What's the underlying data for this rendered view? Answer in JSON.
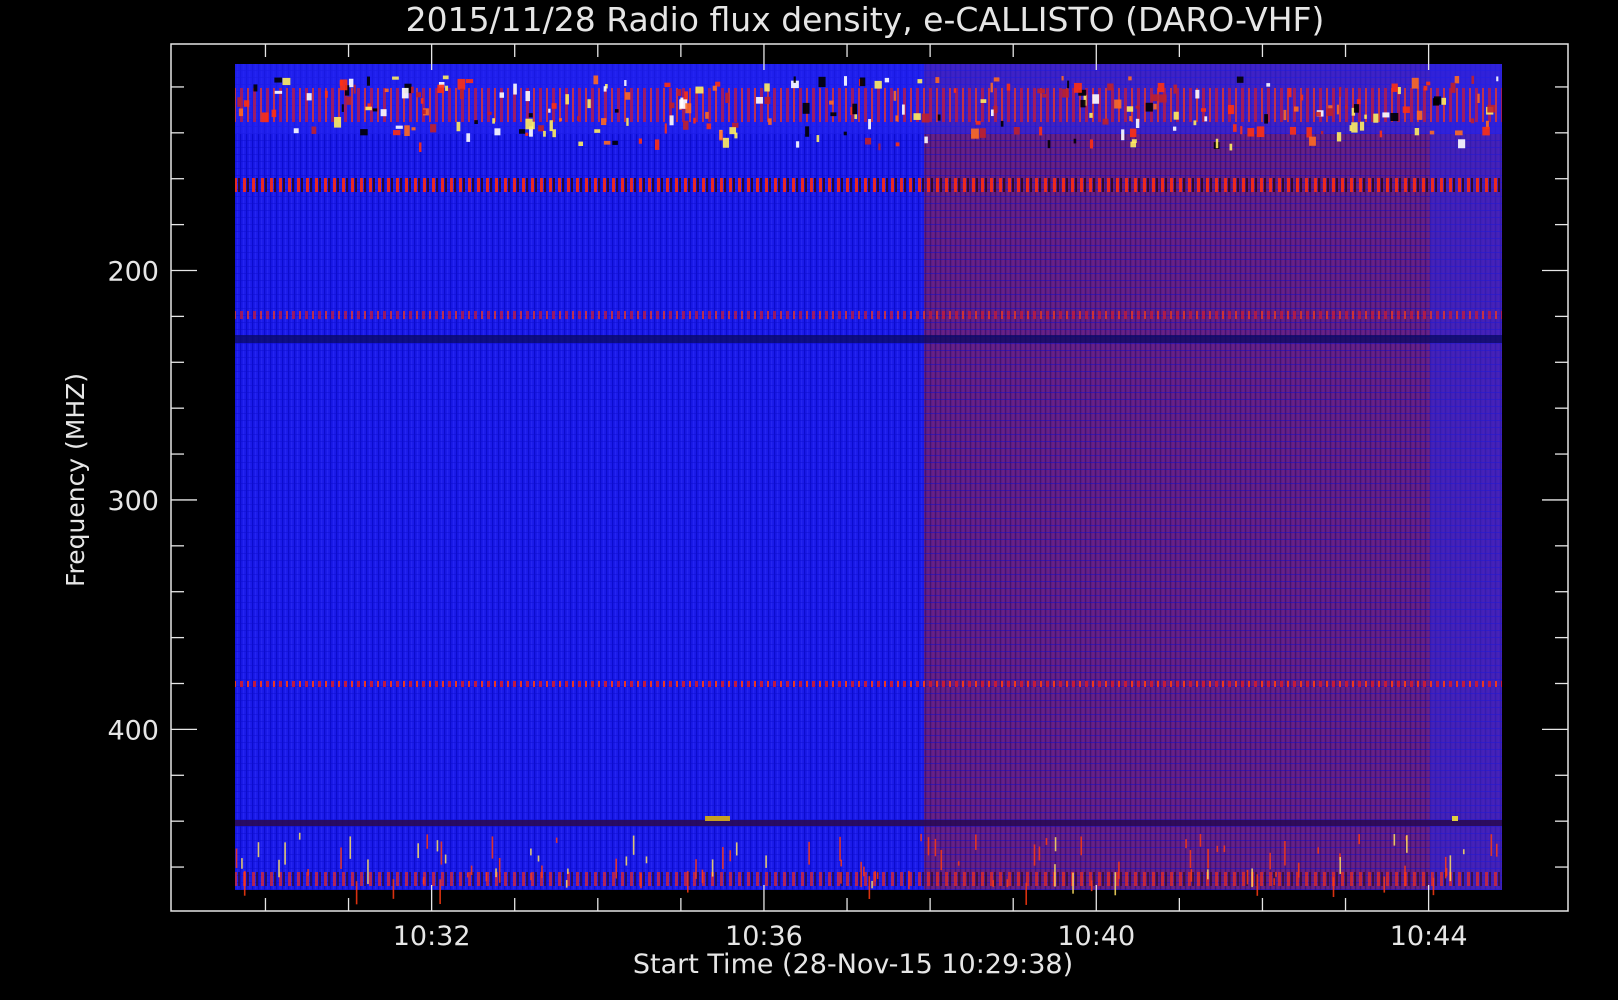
{
  "chart_data": {
    "type": "heatmap",
    "title": "2015/11/28  Radio flux density, e-CALLISTO (DARO-VHF)",
    "xlabel": "Start Time (28-Nov-15 10:29:38)",
    "ylabel": "Frequency (MHZ)",
    "x_range": [
      "10:29:38",
      "10:44:53"
    ],
    "y_range_mhz": [
      110,
      470
    ],
    "y_inverted": true,
    "x_ticks": [
      "10:32",
      "10:36",
      "10:40",
      "10:44"
    ],
    "y_ticks": [
      200,
      300,
      400
    ],
    "frequency_mhz_min": 110,
    "frequency_mhz_max": 470,
    "colors": {
      "background": "#000000",
      "low": "#1a1aff",
      "mid": "#7a1f6b",
      "high": "#ff3a10",
      "peak": "#ffff90"
    },
    "background_shift_time": "10:38:10",
    "interference_bands_mhz": [
      {
        "freq": 128,
        "note": "bright red/yellow/white spikes"
      },
      {
        "freq": 162,
        "note": "continuous red line"
      },
      {
        "freq": 219,
        "note": "red line"
      },
      {
        "freq": 230,
        "note": "dark line"
      },
      {
        "freq": 380,
        "note": "red dotted line"
      },
      {
        "freq": 441,
        "note": "dark/red line"
      },
      {
        "freq": 465,
        "note": "red dotted line"
      }
    ]
  }
}
